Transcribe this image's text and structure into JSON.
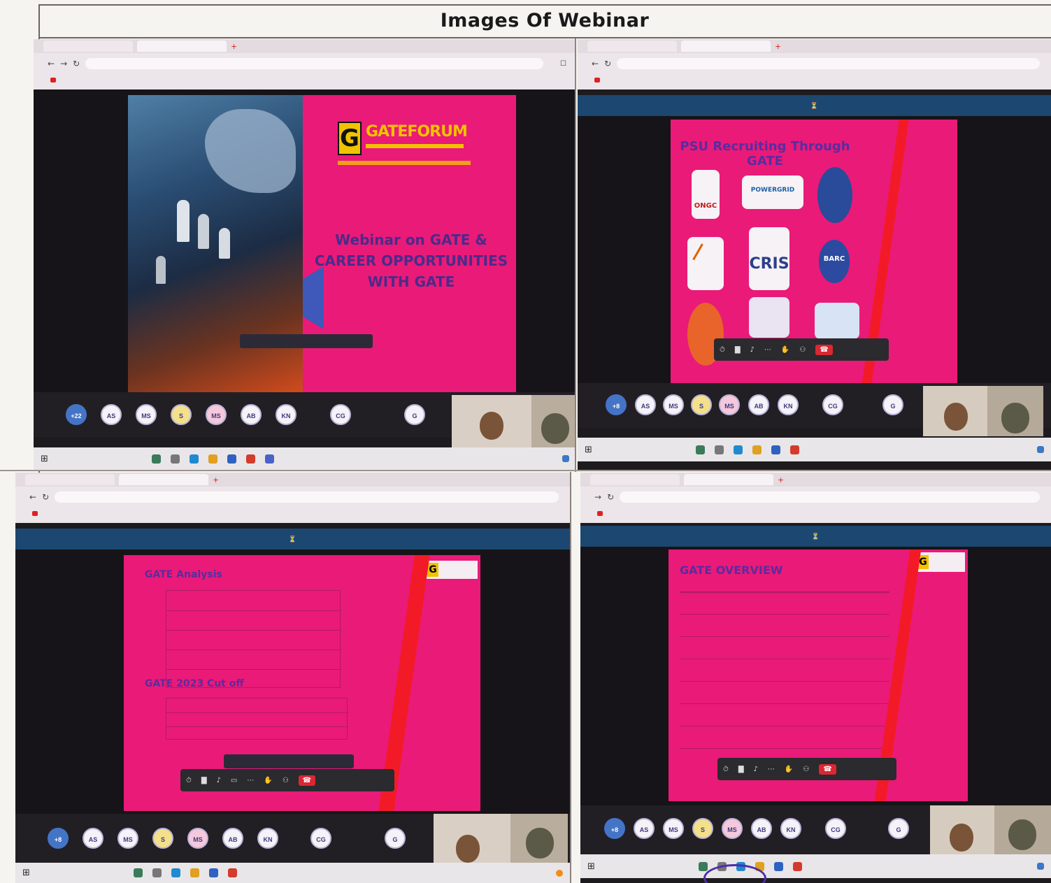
{
  "document": {
    "title": "Images Of Webinar"
  },
  "screenshots": [
    {
      "id": "top-left",
      "slide": {
        "brand": "GATEFORUM",
        "headline_lines": [
          "Webinar on GATE &",
          "CAREER OPPORTUNITIES",
          "WITH GATE"
        ]
      },
      "participants": [
        "+22",
        "AS",
        "MS",
        "S",
        "MS",
        "AB",
        "KN",
        "CG",
        "G"
      ]
    },
    {
      "id": "top-right",
      "slide": {
        "heading": "PSU Recruiting Through GATE",
        "logos": [
          "ONGC",
          "POWERGRID",
          "",
          "",
          "CRIS",
          "BARC",
          "",
          "",
          ""
        ]
      },
      "participants": [
        "+8",
        "AS",
        "MS",
        "S",
        "MS",
        "AB",
        "KN",
        "CG",
        "G"
      ]
    },
    {
      "id": "bottom-left",
      "slide": {
        "heading": "GATE Analysis",
        "subheading": "GATE 2023 Cut off"
      },
      "participants": [
        "+8",
        "AS",
        "MS",
        "S",
        "MS",
        "AB",
        "KN",
        "CG",
        "G"
      ]
    },
    {
      "id": "bottom-right",
      "slide": {
        "heading": "GATE OVERVIEW"
      },
      "participants": [
        "+8",
        "AS",
        "MS",
        "S",
        "MS",
        "AB",
        "KN",
        "CG",
        "G"
      ]
    }
  ],
  "colors": {
    "slide_pink": "#ea1a78",
    "meeting_bar": "#1b4770",
    "stripe_red": "#f31a28"
  }
}
